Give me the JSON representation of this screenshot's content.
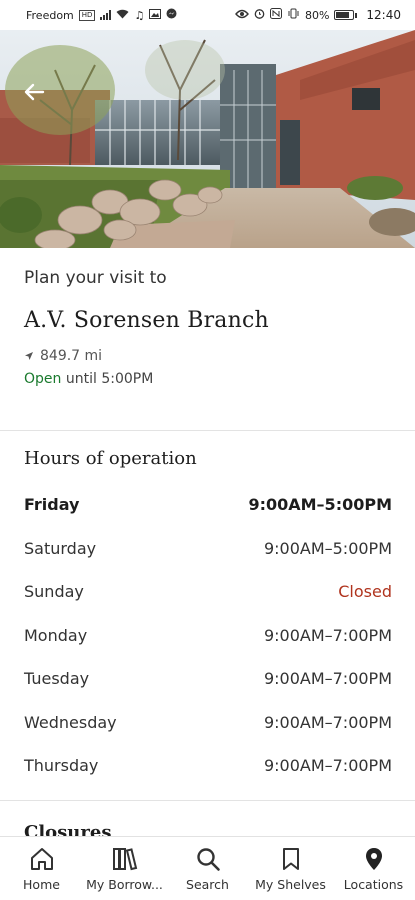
{
  "status_bar": {
    "carrier": "Freedom",
    "carrier_badge": "HD",
    "battery": "80%",
    "time": "12:40"
  },
  "hero": {
    "back_icon": "arrow-left-icon"
  },
  "library": {
    "plan_label": "Plan your visit to",
    "name": "A.V. Sorensen Branch",
    "distance": "849.7 mi",
    "open_status": "Open",
    "open_until": "until 5:00PM"
  },
  "hours": {
    "title": "Hours of operation",
    "rows": [
      {
        "day": "Friday",
        "time": "9:00AM–5:00PM"
      },
      {
        "day": "Saturday",
        "time": "9:00AM–5:00PM"
      },
      {
        "day": "Sunday",
        "time": "Closed"
      },
      {
        "day": "Monday",
        "time": "9:00AM–7:00PM"
      },
      {
        "day": "Tuesday",
        "time": "9:00AM–7:00PM"
      },
      {
        "day": "Wednesday",
        "time": "9:00AM–7:00PM"
      },
      {
        "day": "Thursday",
        "time": "9:00AM–7:00PM"
      }
    ]
  },
  "closures": {
    "title": "Closures"
  },
  "nav": {
    "items": [
      {
        "label": "Home",
        "icon": "home-icon"
      },
      {
        "label": "My Borrow...",
        "icon": "books-icon"
      },
      {
        "label": "Search",
        "icon": "search-icon"
      },
      {
        "label": "My Shelves",
        "icon": "bookmark-icon"
      },
      {
        "label": "Locations",
        "icon": "location-pin-icon"
      }
    ]
  },
  "colors": {
    "open_green": "#1a7a2e",
    "closed_red": "#b0341e"
  }
}
